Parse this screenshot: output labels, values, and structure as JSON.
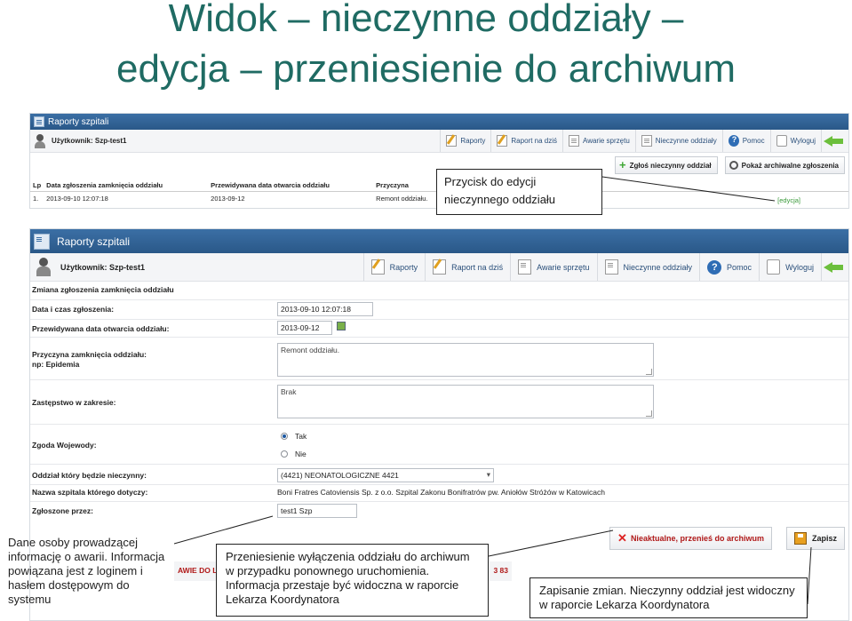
{
  "slide": {
    "title_line1": "Widok – nieczynne oddziały –",
    "title_line2": "edycja – przeniesienie do archiwum"
  },
  "app1": {
    "app_title": "Raporty szpitali",
    "user_label": "Użytkownik: Szp-test1",
    "nav": [
      "Raporty",
      "Raport na dziś",
      "Awarie sprzętu",
      "Nieczynne oddziały",
      "Pomoc",
      "Wyloguj"
    ],
    "actions": {
      "add_label": "Zgłoś nieczynny oddział",
      "archive_label": "Pokaż archiwalne zgłoszenia"
    },
    "table": {
      "headers": [
        "Lp",
        "Data zgłoszenia zamknięcia oddziału",
        "Przewidywana data otwarcia oddziału",
        "Przyczyna"
      ],
      "row": [
        "1.",
        "2013-09-10 12:07:18",
        "2013-09-12",
        "Remont oddziału."
      ]
    },
    "edit_link": "[edycja]"
  },
  "app2": {
    "app_title": "Raporty szpitali",
    "user_label": "Użytkownik: Szp-test1",
    "nav": [
      "Raporty",
      "Raport na dziś",
      "Awarie sprzętu",
      "Nieczynne oddziały",
      "Pomoc",
      "Wyloguj"
    ],
    "form": {
      "title": "Zmiana zgłoszenia zamknięcia oddziału",
      "report_date_label": "Data i czas zgłoszenia:",
      "report_date_value": "2013-09-10 12:07:18",
      "open_date_label": "Przewidywana data otwarcia oddziału:",
      "open_date_value": "2013-09-12",
      "reason_label": "Przyczyna zamknięcia oddziału:",
      "reason_hint": "np: Epidemia",
      "reason_value": "Remont oddziału.",
      "substitute_label": "Zastępstwo w zakresie:",
      "substitute_value": "Brak",
      "consent_label": "Zgoda Wojewody:",
      "consent_yes": "Tak",
      "consent_no": "Nie",
      "department_label": "Oddział który będzie nieczynny:",
      "department_value": "(4421) NEONATOLOGICZNE 4421",
      "hospital_label": "Nazwa szpitala którego dotyczy:",
      "hospital_value": "Boni Fratres Catoviensis Sp. z o.o. Szpital Zakonu Bonifratrów pw. Aniołów Stróżów w Katowicach",
      "reporter_label": "Zgłoszone przez:",
      "reporter_value": "test1 Szp"
    },
    "buttons": {
      "archive_label": "Nieaktualne, przenieś do archiwum",
      "save_label": "Zapisz"
    },
    "footer_fragment_left": "AWIE DO LE",
    "footer_fragment_right": "3 83"
  },
  "callouts": {
    "edit_button": "Przycisk  do edycji nieczynnego oddziału",
    "user_info": "Dane osoby  prowadzącej informację o awarii. Informacja powiązana jest z loginem i hasłem dostępowym do systemu",
    "archive_info": "Przeniesienie wyłączenia oddziału do archiwum w przypadku ponownego uruchomienia. Informacja przestaje być widoczna w raporcie Lekarza Koordynatora",
    "save_info": "Zapisanie zmian. Nieczynny oddział jest widoczny w raporcie Lekarza Koordynatora"
  }
}
